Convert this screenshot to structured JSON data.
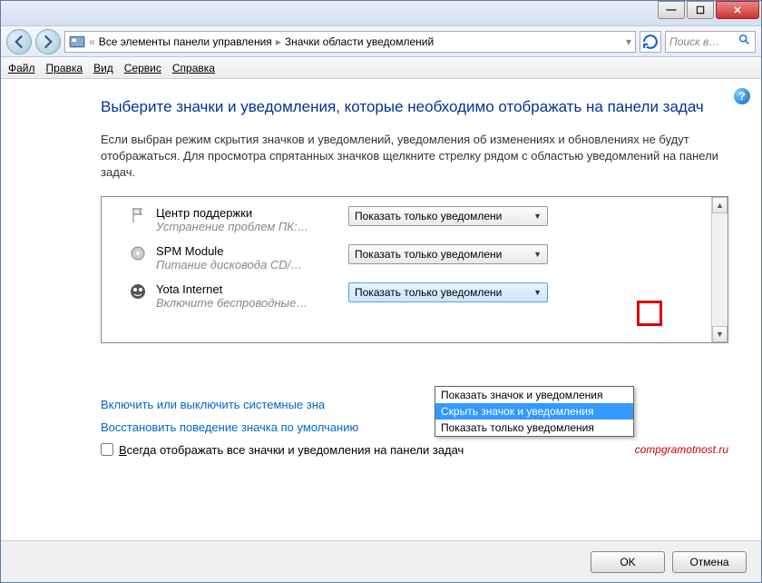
{
  "titlebar": {
    "min": "—",
    "max": "☐",
    "close": "✕"
  },
  "nav": {
    "breadcrumb1": "Все элементы панели управления",
    "breadcrumb2": "Значки области уведомлений",
    "search_placeholder": "Поиск в…"
  },
  "menu": {
    "file": "Файл",
    "edit": "Правка",
    "view": "Вид",
    "service": "Сервис",
    "help": "Справка"
  },
  "heading": "Выберите значки и уведомления, которые необходимо отображать на панели задач",
  "description": "Если выбран режим скрытия значков и уведомлений, уведомления об изменениях и обновлениях не будут отображаться. Для просмотра спрятанных значков щелкните стрелку рядом с областью уведомлений на панели задач.",
  "rows": [
    {
      "title": "Центр поддержки",
      "sub": "Устранение проблем ПК:…",
      "value": "Показать только уведомлени"
    },
    {
      "title": "SPM Module",
      "sub": "Питание дисковода CD/…",
      "value": "Показать только уведомлени"
    },
    {
      "title": "Yota Internet",
      "sub": "Включите беспроводные…",
      "value": "Показать только уведомлени"
    }
  ],
  "dropdown": {
    "opt1": "Показать значок и уведомления",
    "opt2": "Скрыть значок и уведомления",
    "opt3": "Показать только уведомления"
  },
  "link1": "Включить или выключить системные зна",
  "link2": "Восстановить поведение значка по умолчанию",
  "checkbox_label": "Всегда отображать все значки и уведомления на панели задач",
  "watermark": "compgramotnost.ru",
  "buttons": {
    "ok": "OK",
    "cancel": "Отмена"
  }
}
